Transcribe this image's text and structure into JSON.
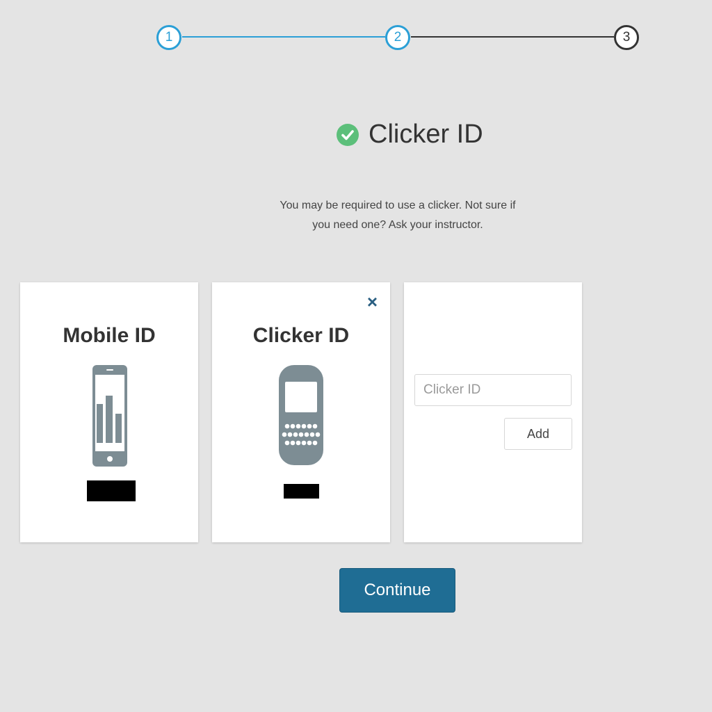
{
  "stepper": {
    "steps": [
      {
        "label": "1",
        "state": "complete"
      },
      {
        "label": "2",
        "state": "current"
      },
      {
        "label": "3",
        "state": "pending"
      }
    ],
    "colors": {
      "active": "#2b9fd6",
      "pending": "#333333"
    }
  },
  "heading": {
    "icon": "check-circle-icon",
    "icon_color": "#5cbf7a",
    "title": "Clicker ID"
  },
  "description": "You may be required to use a clicker. Not sure if you need one? Ask your instructor.",
  "cards": {
    "mobile": {
      "title": "Mobile ID",
      "icon": "mobile-phone-icon"
    },
    "clicker": {
      "title": "Clicker ID",
      "icon": "clicker-device-icon",
      "close_label": "×"
    },
    "entry": {
      "input_placeholder": "Clicker ID",
      "input_value": "",
      "add_label": "Add"
    }
  },
  "continue_label": "Continue",
  "colors": {
    "background": "#e4e4e4",
    "primary_button": "#1f6d94",
    "close_icon": "#2a5f82",
    "device_icon": "#7d8d94"
  }
}
